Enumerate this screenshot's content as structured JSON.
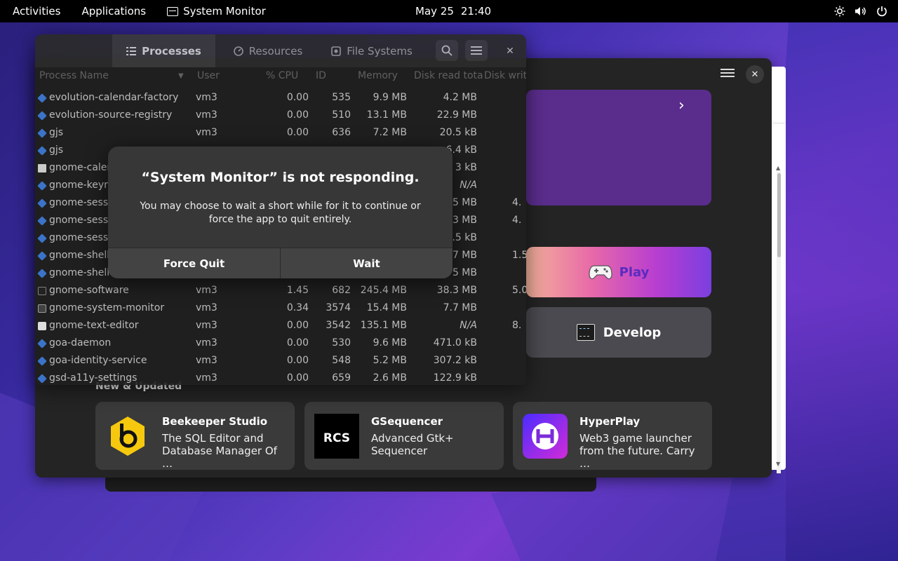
{
  "topbar": {
    "activities": "Activities",
    "applications": "Applications",
    "app_name": "System Monitor",
    "date": "May 25",
    "time": "21:40"
  },
  "sysmon": {
    "tabs": [
      {
        "label": "Processes",
        "active": true
      },
      {
        "label": "Resources",
        "active": false
      },
      {
        "label": "File Systems",
        "active": false
      }
    ],
    "columns": {
      "name": "Process Name",
      "user": "User",
      "cpu": "% CPU",
      "id": "ID",
      "memory": "Memory",
      "disk_read": "Disk read tota",
      "disk_write": "Disk writ"
    },
    "rows": [
      {
        "name": "evolution-calendar-factory",
        "user": "vm3",
        "cpu": "0.00",
        "id": "535",
        "mem": "9.9 MB",
        "disk": "4.2 MB",
        "diskw": ""
      },
      {
        "name": "evolution-source-registry",
        "user": "vm3",
        "cpu": "0.00",
        "id": "510",
        "mem": "13.1 MB",
        "disk": "22.9 MB",
        "diskw": ""
      },
      {
        "name": "gjs",
        "user": "vm3",
        "cpu": "0.00",
        "id": "636",
        "mem": "7.2 MB",
        "disk": "20.5 kB",
        "diskw": ""
      },
      {
        "name": "gjs",
        "user": "",
        "cpu": "",
        "id": "",
        "mem": "",
        "disk": "6.4 kB",
        "diskw": ""
      },
      {
        "name": "gnome-calen",
        "user": "",
        "cpu": "",
        "id": "",
        "mem": "",
        "disk": "3 kB",
        "diskw": ""
      },
      {
        "name": "gnome-keyri",
        "user": "",
        "cpu": "",
        "id": "",
        "mem": "",
        "disk": "N/A",
        "diskw": ""
      },
      {
        "name": "gnome-sessi",
        "user": "",
        "cpu": "",
        "id": "",
        "mem": "",
        "disk": "5 MB",
        "diskw": "4."
      },
      {
        "name": "gnome-sessi",
        "user": "",
        "cpu": "",
        "id": "",
        "mem": "",
        "disk": "3 MB",
        "diskw": "4."
      },
      {
        "name": "gnome-sessi",
        "user": "",
        "cpu": "",
        "id": "",
        "mem": "",
        "disk": "0.5 kB",
        "diskw": ""
      },
      {
        "name": "gnome-shell",
        "user": "",
        "cpu": "",
        "id": "",
        "mem": "",
        "disk": "7 MB",
        "diskw": "1.5"
      },
      {
        "name": "gnome-shell-",
        "user": "",
        "cpu": "",
        "id": "",
        "mem": "",
        "disk": "5 MB",
        "diskw": ""
      },
      {
        "name": "gnome-software",
        "user": "vm3",
        "cpu": "1.45",
        "id": "682",
        "mem": "245.4 MB",
        "disk": "38.3 MB",
        "diskw": "5.0"
      },
      {
        "name": "gnome-system-monitor",
        "user": "vm3",
        "cpu": "0.34",
        "id": "3574",
        "mem": "15.4 MB",
        "disk": "7.7 MB",
        "diskw": ""
      },
      {
        "name": "gnome-text-editor",
        "user": "vm3",
        "cpu": "0.00",
        "id": "3542",
        "mem": "135.1 MB",
        "disk": "N/A",
        "diskw": "8."
      },
      {
        "name": "goa-daemon",
        "user": "vm3",
        "cpu": "0.00",
        "id": "530",
        "mem": "9.6 MB",
        "disk": "471.0 kB",
        "diskw": ""
      },
      {
        "name": "goa-identity-service",
        "user": "vm3",
        "cpu": "0.00",
        "id": "548",
        "mem": "5.2 MB",
        "disk": "307.2 kB",
        "diskw": ""
      },
      {
        "name": "gsd-a11y-settings",
        "user": "vm3",
        "cpu": "0.00",
        "id": "659",
        "mem": "2.6 MB",
        "disk": "122.9 kB",
        "diskw": ""
      }
    ]
  },
  "dialog": {
    "title": "“System Monitor” is not responding.",
    "body": "You may choose to wait a short while for it to continue or force the app to quit entirely.",
    "force_quit": "Force Quit",
    "wait": "Wait"
  },
  "software": {
    "play": "Play",
    "develop": "Develop",
    "new_updated": "New & Updated",
    "apps": [
      {
        "name": "Beekeeper Studio",
        "desc": "The SQL Editor and Database Manager Of …"
      },
      {
        "name": "GSequencer",
        "desc": "Advanced Gtk+ Sequencer"
      },
      {
        "name": "HyperPlay",
        "desc": "Web3 game launcher from the future. Carry …"
      }
    ]
  }
}
